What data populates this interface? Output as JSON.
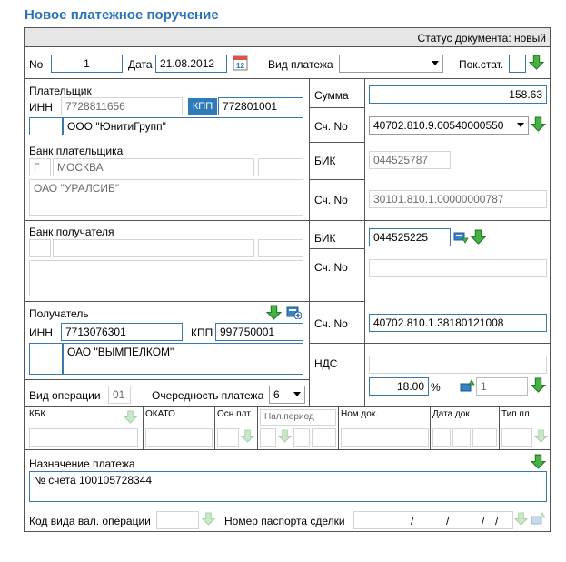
{
  "title": "Новое платежное поручение",
  "status": "Статус документа: новый",
  "header": {
    "no_label": "No",
    "no_value": "1",
    "date_label": "Дата",
    "date_value": "21.08.2012",
    "payment_type_label": "Вид платежа",
    "payment_type_value": "",
    "pok_stat_label": "Пок.стат.",
    "pok_stat_value": ""
  },
  "payer": {
    "section_label": "Плательщик",
    "inn_label": "ИНН",
    "inn_value": "7728811656",
    "kpp_label": "КПП",
    "kpp_value": "772801001",
    "name_value": "ООО \"ЮнитиГрупп\""
  },
  "payer_bank": {
    "section_label": "Банк плательщика",
    "city_type": "Г",
    "city": "МОСКВА",
    "name": "ОАО \"УРАЛСИБ\"",
    "bik_label": "БИК",
    "bik_value": "044525787",
    "acc_label": "Сч. No",
    "acc_value": "30101.810.1.00000000787"
  },
  "amount": {
    "label": "Сумма",
    "value": "158.63"
  },
  "payer_account": {
    "label": "Сч. No",
    "value": "40702.810.9.00540000550"
  },
  "payee_bank": {
    "section_label": "Банк получателя",
    "bik_label": "БИК",
    "bik_value": "044525225",
    "acc_label": "Сч. No",
    "acc_value": ""
  },
  "payee": {
    "section_label": "Получатель",
    "inn_label": "ИНН",
    "inn_value": "7713076301",
    "kpp_label": "КПП",
    "kpp_value": "997750001",
    "name_value": "ОАО \"ВЫМПЕЛКОМ\"",
    "acc_label": "Сч. No",
    "acc_value": "40702.810.1.38180121008"
  },
  "vat": {
    "label": "НДС",
    "rate": "18.00",
    "percent_sign": "%",
    "mode": "1"
  },
  "operation": {
    "type_label": "Вид операции",
    "type_value": "01",
    "priority_label": "Очередность платежа",
    "priority_value": "6"
  },
  "tax": {
    "kbk_label": "КБК",
    "okato_label": "ОКАТО",
    "basis_label": "Осн.плт.",
    "period_placeholder": "Нал.период",
    "doc_no_label": "Ном.док.",
    "doc_date_label": "Дата док.",
    "pay_type_label": "Тип пл."
  },
  "purpose": {
    "label": "Назначение платежа",
    "value": "№ счета 100105728344"
  },
  "footer": {
    "currency_op_label": "Код вида вал. операции",
    "passport_label": "Номер паспорта сделки",
    "passport_sep": "/"
  },
  "colors": {
    "title": "#2b73b7",
    "accent_border": "#3a78ad",
    "green_arrow": "#3aa53a"
  }
}
